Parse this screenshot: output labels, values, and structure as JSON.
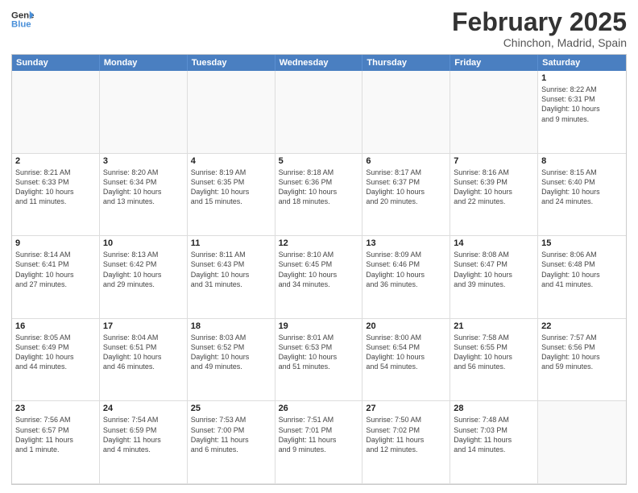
{
  "logo": {
    "line1": "General",
    "line2": "Blue"
  },
  "title": "February 2025",
  "location": "Chinchon, Madrid, Spain",
  "headers": [
    "Sunday",
    "Monday",
    "Tuesday",
    "Wednesday",
    "Thursday",
    "Friday",
    "Saturday"
  ],
  "weeks": [
    [
      {
        "day": "",
        "empty": true,
        "lines": []
      },
      {
        "day": "",
        "empty": true,
        "lines": []
      },
      {
        "day": "",
        "empty": true,
        "lines": []
      },
      {
        "day": "",
        "empty": true,
        "lines": []
      },
      {
        "day": "",
        "empty": true,
        "lines": []
      },
      {
        "day": "",
        "empty": true,
        "lines": []
      },
      {
        "day": "1",
        "empty": false,
        "lines": [
          "Sunrise: 8:22 AM",
          "Sunset: 6:31 PM",
          "Daylight: 10 hours",
          "and 9 minutes."
        ]
      }
    ],
    [
      {
        "day": "2",
        "empty": false,
        "lines": [
          "Sunrise: 8:21 AM",
          "Sunset: 6:33 PM",
          "Daylight: 10 hours",
          "and 11 minutes."
        ]
      },
      {
        "day": "3",
        "empty": false,
        "lines": [
          "Sunrise: 8:20 AM",
          "Sunset: 6:34 PM",
          "Daylight: 10 hours",
          "and 13 minutes."
        ]
      },
      {
        "day": "4",
        "empty": false,
        "lines": [
          "Sunrise: 8:19 AM",
          "Sunset: 6:35 PM",
          "Daylight: 10 hours",
          "and 15 minutes."
        ]
      },
      {
        "day": "5",
        "empty": false,
        "lines": [
          "Sunrise: 8:18 AM",
          "Sunset: 6:36 PM",
          "Daylight: 10 hours",
          "and 18 minutes."
        ]
      },
      {
        "day": "6",
        "empty": false,
        "lines": [
          "Sunrise: 8:17 AM",
          "Sunset: 6:37 PM",
          "Daylight: 10 hours",
          "and 20 minutes."
        ]
      },
      {
        "day": "7",
        "empty": false,
        "lines": [
          "Sunrise: 8:16 AM",
          "Sunset: 6:39 PM",
          "Daylight: 10 hours",
          "and 22 minutes."
        ]
      },
      {
        "day": "8",
        "empty": false,
        "lines": [
          "Sunrise: 8:15 AM",
          "Sunset: 6:40 PM",
          "Daylight: 10 hours",
          "and 24 minutes."
        ]
      }
    ],
    [
      {
        "day": "9",
        "empty": false,
        "lines": [
          "Sunrise: 8:14 AM",
          "Sunset: 6:41 PM",
          "Daylight: 10 hours",
          "and 27 minutes."
        ]
      },
      {
        "day": "10",
        "empty": false,
        "lines": [
          "Sunrise: 8:13 AM",
          "Sunset: 6:42 PM",
          "Daylight: 10 hours",
          "and 29 minutes."
        ]
      },
      {
        "day": "11",
        "empty": false,
        "lines": [
          "Sunrise: 8:11 AM",
          "Sunset: 6:43 PM",
          "Daylight: 10 hours",
          "and 31 minutes."
        ]
      },
      {
        "day": "12",
        "empty": false,
        "lines": [
          "Sunrise: 8:10 AM",
          "Sunset: 6:45 PM",
          "Daylight: 10 hours",
          "and 34 minutes."
        ]
      },
      {
        "day": "13",
        "empty": false,
        "lines": [
          "Sunrise: 8:09 AM",
          "Sunset: 6:46 PM",
          "Daylight: 10 hours",
          "and 36 minutes."
        ]
      },
      {
        "day": "14",
        "empty": false,
        "lines": [
          "Sunrise: 8:08 AM",
          "Sunset: 6:47 PM",
          "Daylight: 10 hours",
          "and 39 minutes."
        ]
      },
      {
        "day": "15",
        "empty": false,
        "lines": [
          "Sunrise: 8:06 AM",
          "Sunset: 6:48 PM",
          "Daylight: 10 hours",
          "and 41 minutes."
        ]
      }
    ],
    [
      {
        "day": "16",
        "empty": false,
        "lines": [
          "Sunrise: 8:05 AM",
          "Sunset: 6:49 PM",
          "Daylight: 10 hours",
          "and 44 minutes."
        ]
      },
      {
        "day": "17",
        "empty": false,
        "lines": [
          "Sunrise: 8:04 AM",
          "Sunset: 6:51 PM",
          "Daylight: 10 hours",
          "and 46 minutes."
        ]
      },
      {
        "day": "18",
        "empty": false,
        "lines": [
          "Sunrise: 8:03 AM",
          "Sunset: 6:52 PM",
          "Daylight: 10 hours",
          "and 49 minutes."
        ]
      },
      {
        "day": "19",
        "empty": false,
        "lines": [
          "Sunrise: 8:01 AM",
          "Sunset: 6:53 PM",
          "Daylight: 10 hours",
          "and 51 minutes."
        ]
      },
      {
        "day": "20",
        "empty": false,
        "lines": [
          "Sunrise: 8:00 AM",
          "Sunset: 6:54 PM",
          "Daylight: 10 hours",
          "and 54 minutes."
        ]
      },
      {
        "day": "21",
        "empty": false,
        "lines": [
          "Sunrise: 7:58 AM",
          "Sunset: 6:55 PM",
          "Daylight: 10 hours",
          "and 56 minutes."
        ]
      },
      {
        "day": "22",
        "empty": false,
        "lines": [
          "Sunrise: 7:57 AM",
          "Sunset: 6:56 PM",
          "Daylight: 10 hours",
          "and 59 minutes."
        ]
      }
    ],
    [
      {
        "day": "23",
        "empty": false,
        "lines": [
          "Sunrise: 7:56 AM",
          "Sunset: 6:57 PM",
          "Daylight: 11 hours",
          "and 1 minute."
        ]
      },
      {
        "day": "24",
        "empty": false,
        "lines": [
          "Sunrise: 7:54 AM",
          "Sunset: 6:59 PM",
          "Daylight: 11 hours",
          "and 4 minutes."
        ]
      },
      {
        "day": "25",
        "empty": false,
        "lines": [
          "Sunrise: 7:53 AM",
          "Sunset: 7:00 PM",
          "Daylight: 11 hours",
          "and 6 minutes."
        ]
      },
      {
        "day": "26",
        "empty": false,
        "lines": [
          "Sunrise: 7:51 AM",
          "Sunset: 7:01 PM",
          "Daylight: 11 hours",
          "and 9 minutes."
        ]
      },
      {
        "day": "27",
        "empty": false,
        "lines": [
          "Sunrise: 7:50 AM",
          "Sunset: 7:02 PM",
          "Daylight: 11 hours",
          "and 12 minutes."
        ]
      },
      {
        "day": "28",
        "empty": false,
        "lines": [
          "Sunrise: 7:48 AM",
          "Sunset: 7:03 PM",
          "Daylight: 11 hours",
          "and 14 minutes."
        ]
      },
      {
        "day": "",
        "empty": true,
        "lines": []
      }
    ]
  ]
}
